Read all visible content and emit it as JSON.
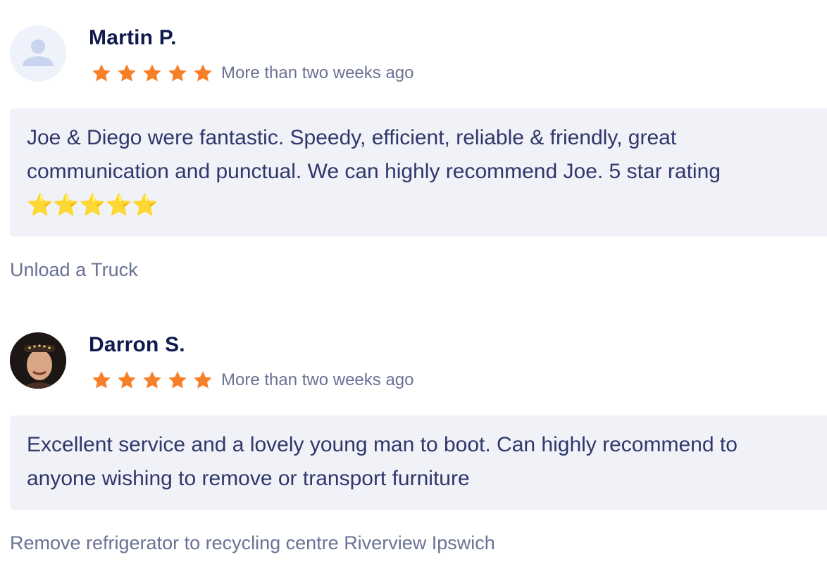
{
  "reviews": [
    {
      "name": "Martin P.",
      "rating": 5,
      "date": "More than two weeks ago",
      "text": "Joe & Diego were fantastic. Speedy, efficient, reliable & friendly, great communication and punctual. We can highly recommend Joe. 5 star rating ⭐⭐⭐⭐⭐",
      "service": "Unload a Truck",
      "avatar": "person-placeholder-icon"
    },
    {
      "name": "Darron S.",
      "rating": 5,
      "date": "More than two weeks ago",
      "text": "Excellent service and a lovely young man to boot. Can highly recommend to anyone wishing to remove or transport furniture",
      "service": "Remove refrigerator to recycling centre Riverview Ipswich",
      "avatar": "user-photo"
    }
  ],
  "colors": {
    "star": "#f77f28",
    "name": "#0f1a4f",
    "bubble_bg": "#f1f2f7",
    "muted": "#6b7295"
  }
}
